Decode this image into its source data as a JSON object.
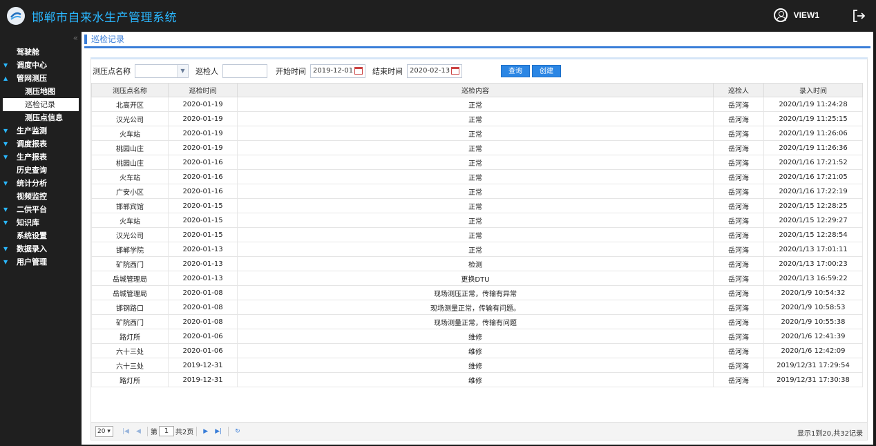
{
  "app": {
    "title": "邯郸市自来水生产管理系统",
    "user": "VIEW1"
  },
  "sidebar": {
    "items": [
      {
        "label": "驾驶舱",
        "arrow": "",
        "sub": false,
        "active": false
      },
      {
        "label": "调度中心",
        "arrow": "▼",
        "sub": false,
        "active": false
      },
      {
        "label": "管网测压",
        "arrow": "▲",
        "sub": false,
        "active": false
      },
      {
        "label": "测压地图",
        "arrow": "",
        "sub": true,
        "active": false
      },
      {
        "label": "巡检记录",
        "arrow": "",
        "sub": true,
        "active": true
      },
      {
        "label": "测压点信息",
        "arrow": "",
        "sub": true,
        "active": false
      },
      {
        "label": "生产监测",
        "arrow": "▼",
        "sub": false,
        "active": false
      },
      {
        "label": "调度报表",
        "arrow": "▼",
        "sub": false,
        "active": false
      },
      {
        "label": "生产报表",
        "arrow": "▼",
        "sub": false,
        "active": false
      },
      {
        "label": "历史查询",
        "arrow": "",
        "sub": false,
        "active": false
      },
      {
        "label": "统计分析",
        "arrow": "▼",
        "sub": false,
        "active": false
      },
      {
        "label": "视频监控",
        "arrow": "",
        "sub": false,
        "active": false
      },
      {
        "label": "二供平台",
        "arrow": "▼",
        "sub": false,
        "active": false
      },
      {
        "label": "知识库",
        "arrow": "▼",
        "sub": false,
        "active": false
      },
      {
        "label": "系统设置",
        "arrow": "",
        "sub": false,
        "active": false
      },
      {
        "label": "数据录入",
        "arrow": "▼",
        "sub": false,
        "active": false
      },
      {
        "label": "用户管理",
        "arrow": "▼",
        "sub": false,
        "active": false
      }
    ]
  },
  "page": {
    "title": "巡检记录"
  },
  "filters": {
    "point_label": "测压点名称",
    "inspector_label": "巡检人",
    "start_label": "开始时间",
    "start_value": "2019-12-01",
    "end_label": "结束时间",
    "end_value": "2020-02-13",
    "query_label": "查询",
    "create_label": "创建"
  },
  "table": {
    "columns": [
      "测压点名称",
      "巡检时间",
      "巡检内容",
      "巡检人",
      "录入时间"
    ],
    "rows": [
      [
        "北高开区",
        "2020-01-19",
        "正常",
        "岳河海",
        "2020/1/19 11:24:28"
      ],
      [
        "汉光公司",
        "2020-01-19",
        "正常",
        "岳河海",
        "2020/1/19 11:25:15"
      ],
      [
        "火车站",
        "2020-01-19",
        "正常",
        "岳河海",
        "2020/1/19 11:26:06"
      ],
      [
        "桃园山庄",
        "2020-01-19",
        "正常",
        "岳河海",
        "2020/1/19 11:26:36"
      ],
      [
        "桃园山庄",
        "2020-01-16",
        "正常",
        "岳河海",
        "2020/1/16 17:21:52"
      ],
      [
        "火车站",
        "2020-01-16",
        "正常",
        "岳河海",
        "2020/1/16 17:21:05"
      ],
      [
        "广安小区",
        "2020-01-16",
        "正常",
        "岳河海",
        "2020/1/16 17:22:19"
      ],
      [
        "邯郸宾馆",
        "2020-01-15",
        "正常",
        "岳河海",
        "2020/1/15 12:28:25"
      ],
      [
        "火车站",
        "2020-01-15",
        "正常",
        "岳河海",
        "2020/1/15 12:29:27"
      ],
      [
        "汉光公司",
        "2020-01-15",
        "正常",
        "岳河海",
        "2020/1/15 12:28:54"
      ],
      [
        "邯郸学院",
        "2020-01-13",
        "正常",
        "岳河海",
        "2020/1/13 17:01:11"
      ],
      [
        "矿院西门",
        "2020-01-13",
        "检测",
        "岳河海",
        "2020/1/13 17:00:23"
      ],
      [
        "岳城管理局",
        "2020-01-13",
        "更换DTU",
        "岳河海",
        "2020/1/13 16:59:22"
      ],
      [
        "岳城管理局",
        "2020-01-08",
        "现场测压正常，传输有异常",
        "岳河海",
        "2020/1/9 10:54:32"
      ],
      [
        "邯钢路口",
        "2020-01-08",
        "现场测量正常，传输有问题。",
        "岳河海",
        "2020/1/9 10:58:53"
      ],
      [
        "矿院西门",
        "2020-01-08",
        "现场测量正常，传输有问题",
        "岳河海",
        "2020/1/9 10:55:38"
      ],
      [
        "路灯所",
        "2020-01-06",
        "维修",
        "岳河海",
        "2020/1/6 12:41:39"
      ],
      [
        "六十三处",
        "2020-01-06",
        "维修",
        "岳河海",
        "2020/1/6 12:42:09"
      ],
      [
        "六十三处",
        "2019-12-31",
        "维修",
        "岳河海",
        "2019/12/31 17:29:54"
      ],
      [
        "路灯所",
        "2019-12-31",
        "维修",
        "岳河海",
        "2019/12/31 17:30:38"
      ]
    ]
  },
  "pager": {
    "page_size": "20",
    "page_prefix": "第",
    "page_value": "1",
    "page_suffix": "共2页",
    "info": "显示1到20,共32记录"
  }
}
